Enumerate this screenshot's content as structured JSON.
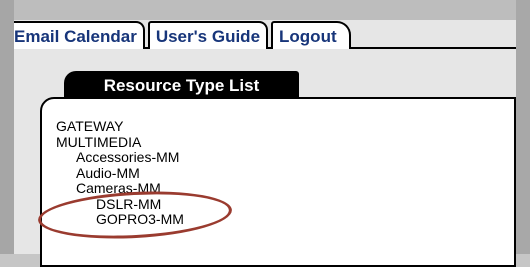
{
  "nav": {
    "tabs": [
      {
        "label": "Email Calendar"
      },
      {
        "label": "User's Guide"
      },
      {
        "label": "Logout"
      }
    ]
  },
  "panel": {
    "tab_label": "Resource Type List",
    "items": [
      {
        "label": "GATEWAY",
        "level": 0
      },
      {
        "label": "MULTIMEDIA",
        "level": 0
      },
      {
        "label": "Accessories-MM",
        "level": 1
      },
      {
        "label": "Audio-MM",
        "level": 1
      },
      {
        "label": "Cameras-MM",
        "level": 1
      },
      {
        "label": "DSLR-MM",
        "level": 2
      },
      {
        "label": "GOPRO3-MM",
        "level": 2
      }
    ]
  },
  "annotation": {
    "color": "#9a3b2f",
    "shape": "oval"
  }
}
